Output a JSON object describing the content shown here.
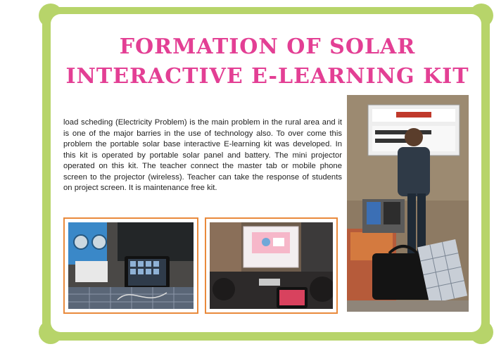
{
  "page": {
    "title_line1": "Formation of Solar",
    "title_line2": "Interactive E-learning Kit",
    "body": "load scheding (Electricity Problem) is the main problem in the rural area and it is one of the major barries in the use of technology also. To over come this problem the portable solar base interactive E-learning kit was developed. In this kit is operated by portable solar panel and battery. The mini projector operated on this kit. The teacher connect the master tab or mobile phone screen to the projector (wireless). Teacher can take the response of students on project screen. It is maintenance free kit."
  },
  "photos": {
    "left": "solar-kit-with-tablet-photo",
    "middle": "projector-screen-classroom-photo",
    "right": "teacher-with-solar-kit-photo"
  },
  "colors": {
    "border_green": "#b7d46a",
    "title_pink": "#e33f94",
    "photo_border_orange": "#e98a3c"
  }
}
